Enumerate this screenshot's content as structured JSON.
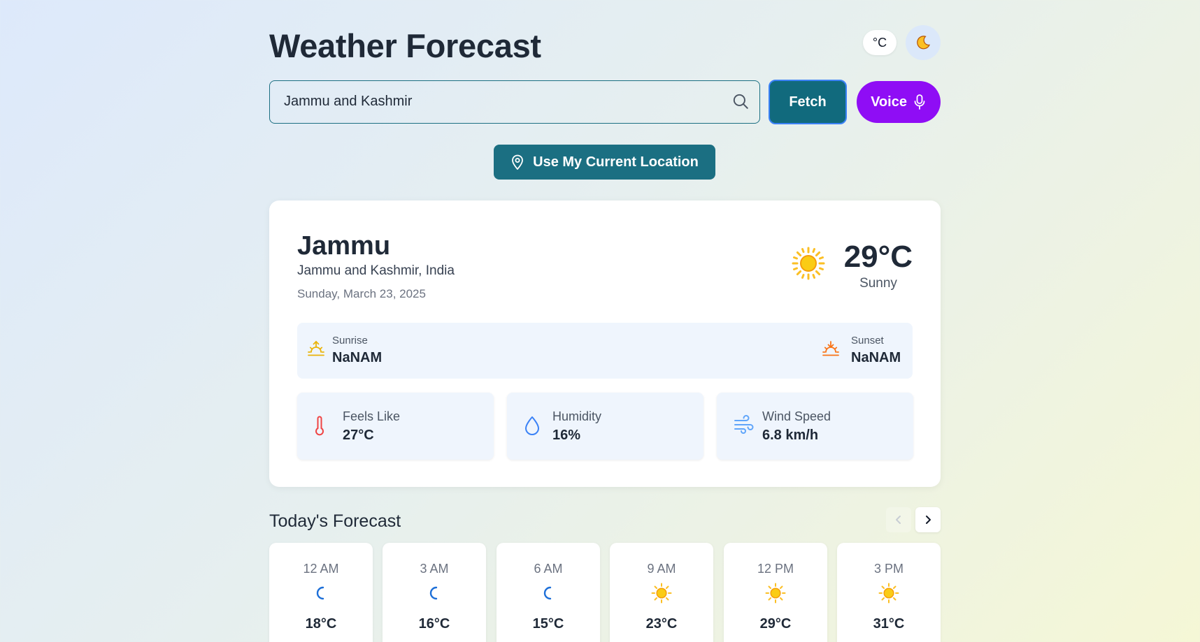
{
  "header": {
    "title": "Weather Forecast",
    "unit_toggle": "°C",
    "theme_icon": "moon-icon"
  },
  "search": {
    "value": "Jammu and Kashmir",
    "placeholder": "",
    "fetch_label": "Fetch",
    "voice_label": "Voice",
    "location_label": "Use My Current Location"
  },
  "current": {
    "city": "Jammu",
    "region": "Jammu and Kashmir, India",
    "date": "Sunday, March 23, 2025",
    "temp": "29°C",
    "condition": "Sunny",
    "icon": "sun-icon",
    "sunrise_label": "Sunrise",
    "sunrise_value": "NaNAM",
    "sunset_label": "Sunset",
    "sunset_value": "NaNAM",
    "stats": [
      {
        "label": "Feels Like",
        "value": "27°C",
        "icon": "thermometer-icon"
      },
      {
        "label": "Humidity",
        "value": "16%",
        "icon": "droplet-icon"
      },
      {
        "label": "Wind Speed",
        "value": "6.8 km/h",
        "icon": "wind-icon"
      }
    ]
  },
  "forecast": {
    "title": "Today's Forecast",
    "items": [
      {
        "time": "12 AM",
        "icon": "moon-icon",
        "temp": "18°C"
      },
      {
        "time": "3 AM",
        "icon": "moon-icon",
        "temp": "16°C"
      },
      {
        "time": "6 AM",
        "icon": "moon-icon",
        "temp": "15°C"
      },
      {
        "time": "9 AM",
        "icon": "sun-icon",
        "temp": "23°C"
      },
      {
        "time": "12 PM",
        "icon": "sun-icon",
        "temp": "29°C"
      },
      {
        "time": "3 PM",
        "icon": "sun-icon",
        "temp": "31°C"
      }
    ]
  },
  "colors": {
    "primary": "#1b6f82",
    "voice": "#8f0df5",
    "sun": "#fbbf24",
    "moon": "#1d6fd8",
    "thermometer": "#ef4444",
    "droplet": "#3b82f6",
    "wind": "#60a5fa"
  }
}
